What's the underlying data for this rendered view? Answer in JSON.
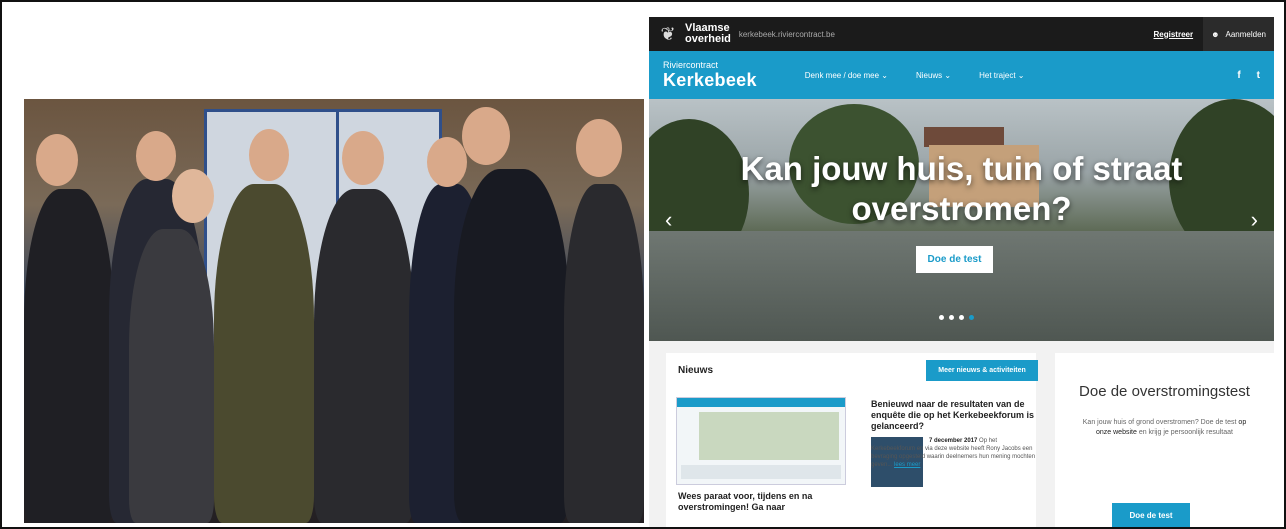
{
  "site": {
    "brand_line1": "Vlaamse",
    "brand_line2": "overheid",
    "domain": "kerkebeek.riviercontract.be",
    "register": "Registreer",
    "login": "Aanmelden",
    "site_subtitle": "Riviercontract",
    "site_title": "Kerkebeek",
    "nav": [
      "Denk mee / doe mee ⌄",
      "Nieuws ⌄",
      "Het traject ⌄"
    ],
    "social": [
      "f",
      "t"
    ],
    "hero": {
      "headline_line1": "Kan jouw huis, tuin of straat",
      "headline_line2": "overstromen?",
      "button": "Doe de test",
      "prev": "‹",
      "next": "›"
    },
    "news": {
      "title": "Nieuws",
      "button": "Meer nieuws & activiteiten",
      "article1_title": "Benieuwd naar de resultaten van de enquête die op het Kerkebeekforum is gelanceerd?",
      "article1_date": "7 december 2017",
      "article1_text": "Op het Kerkebeekforum en via deze website heeft Rony Jacobs een bevraging opgesteld waarin deelnemers hun mening mochten geven...",
      "article1_more": "lees meer",
      "article2_title": "Wees paraat voor, tijdens en na overstromingen! Ga naar"
    },
    "test": {
      "title": "Doe de overstromingstest",
      "text_a": "Kan jouw huis of grond overstromen? Doe de test",
      "link": "op onze website",
      "text_b": "en krijg je persoonlijk resultaat",
      "button": "Doe de test"
    }
  },
  "colors": {
    "accent": "#1a9bc9",
    "topbar": "#1b1b1b"
  }
}
